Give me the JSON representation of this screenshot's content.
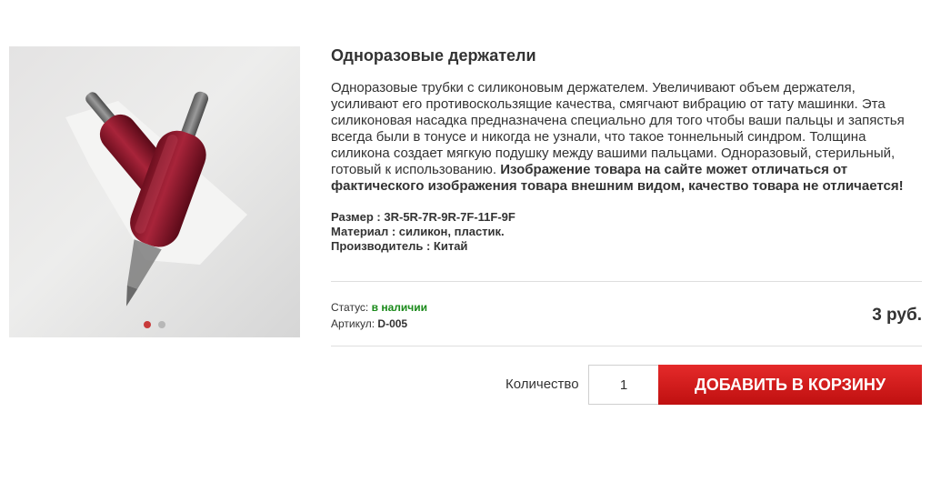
{
  "product": {
    "title": "Одноразовые держатели",
    "description": "Одноразовые трубки с силиконовым держателем. Увеличивают объем держателя, усиливают его противоскользящие качества, смягчают вибрацию от тату машинки. Эта силиконовая насадка предназначена специально для того чтобы ваши пальцы и запястья всегда были в тонусе и никогда не узнали, что такое тоннельный синдром. Толщина силикона создает мягкую подушку между вашими пальцами. Одноразовый, стерильный, готовый к использованию.",
    "notice": "Изображение товара на сайте может отличаться от фактического изображения товара внешним видом, качество товара не отличается!",
    "properties": [
      "Размер : 3R-5R-7R-9R-7F-11F-9F",
      "Материал : силикон, пластик.",
      "Производитель : Китай"
    ],
    "status_label": "Статус:",
    "status_value": "в наличии",
    "sku_label": "Артикул:",
    "sku_value": "D-005",
    "price": "3 руб."
  },
  "gallery": {
    "slides": 2,
    "active_slide": 1
  },
  "cart": {
    "quantity_label": "Количество",
    "quantity_value": "1",
    "add_button_label": "ДОБАВИТЬ В КОРЗИНУ"
  },
  "colors": {
    "accent": "#d21d1d",
    "in_stock": "#1a8a1a",
    "active_dot": "#c83a3a"
  }
}
